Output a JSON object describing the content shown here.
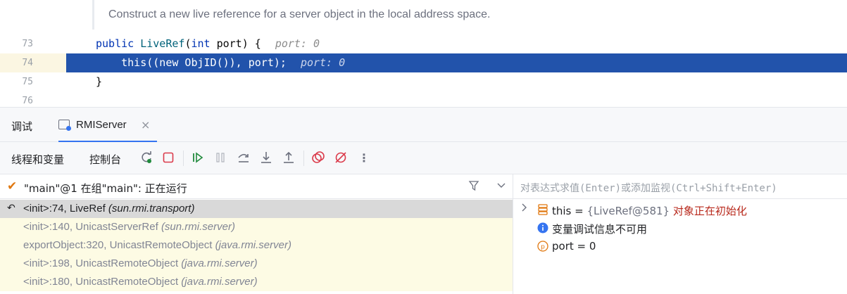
{
  "editor": {
    "doc_comment": "Construct a new live reference for a server object in the local address space.",
    "lines": [
      {
        "num": "73",
        "kw1": "public",
        "fn": "LiveRef",
        "open": "(",
        "kw2": "int",
        "rest": " port) {",
        "hint": "port: 0"
      },
      {
        "num": "74",
        "code": "    this((new ObjID()), port);",
        "hint": "port: 0"
      },
      {
        "num": "75",
        "code": "}"
      },
      {
        "num": "76",
        "code": ""
      }
    ]
  },
  "tool_window": {
    "debug_label": "调试",
    "session_tab": "RMIServer",
    "close_glyph": "×"
  },
  "toolbar": {
    "tab_threads": "线程和变量",
    "tab_console": "控制台"
  },
  "frames_panel": {
    "thread_status": "\"main\"@1 在组\"main\": 正在运行",
    "frames": [
      {
        "method": "<init>:74, LiveRef ",
        "pkg": "(sun.rmi.transport)"
      },
      {
        "method": "<init>:140, UnicastServerRef ",
        "pkg": "(sun.rmi.server)"
      },
      {
        "method": "exportObject:320, UnicastRemoteObject ",
        "pkg": "(java.rmi.server)"
      },
      {
        "method": "<init>:198, UnicastRemoteObject ",
        "pkg": "(java.rmi.server)"
      },
      {
        "method": "<init>:180, UnicastRemoteObject ",
        "pkg": "(java.rmi.server)"
      }
    ]
  },
  "variables_panel": {
    "watch_placeholder": "对表达式求值(Enter)或添加监视(Ctrl+Shift+Enter)",
    "vars": [
      {
        "name": "this",
        "eq": " = ",
        "obj": "{LiveRef@581}",
        "note": " 对象正在初始化"
      },
      {
        "info": "变量调试信息不可用"
      },
      {
        "name": "port",
        "eq": " = ",
        "value": "0"
      }
    ]
  },
  "colors": {
    "selection": "#2253ab",
    "keyword": "#0033b3",
    "function": "#00627a",
    "accent": "#3574f0",
    "warning_text": "#b8281b"
  }
}
